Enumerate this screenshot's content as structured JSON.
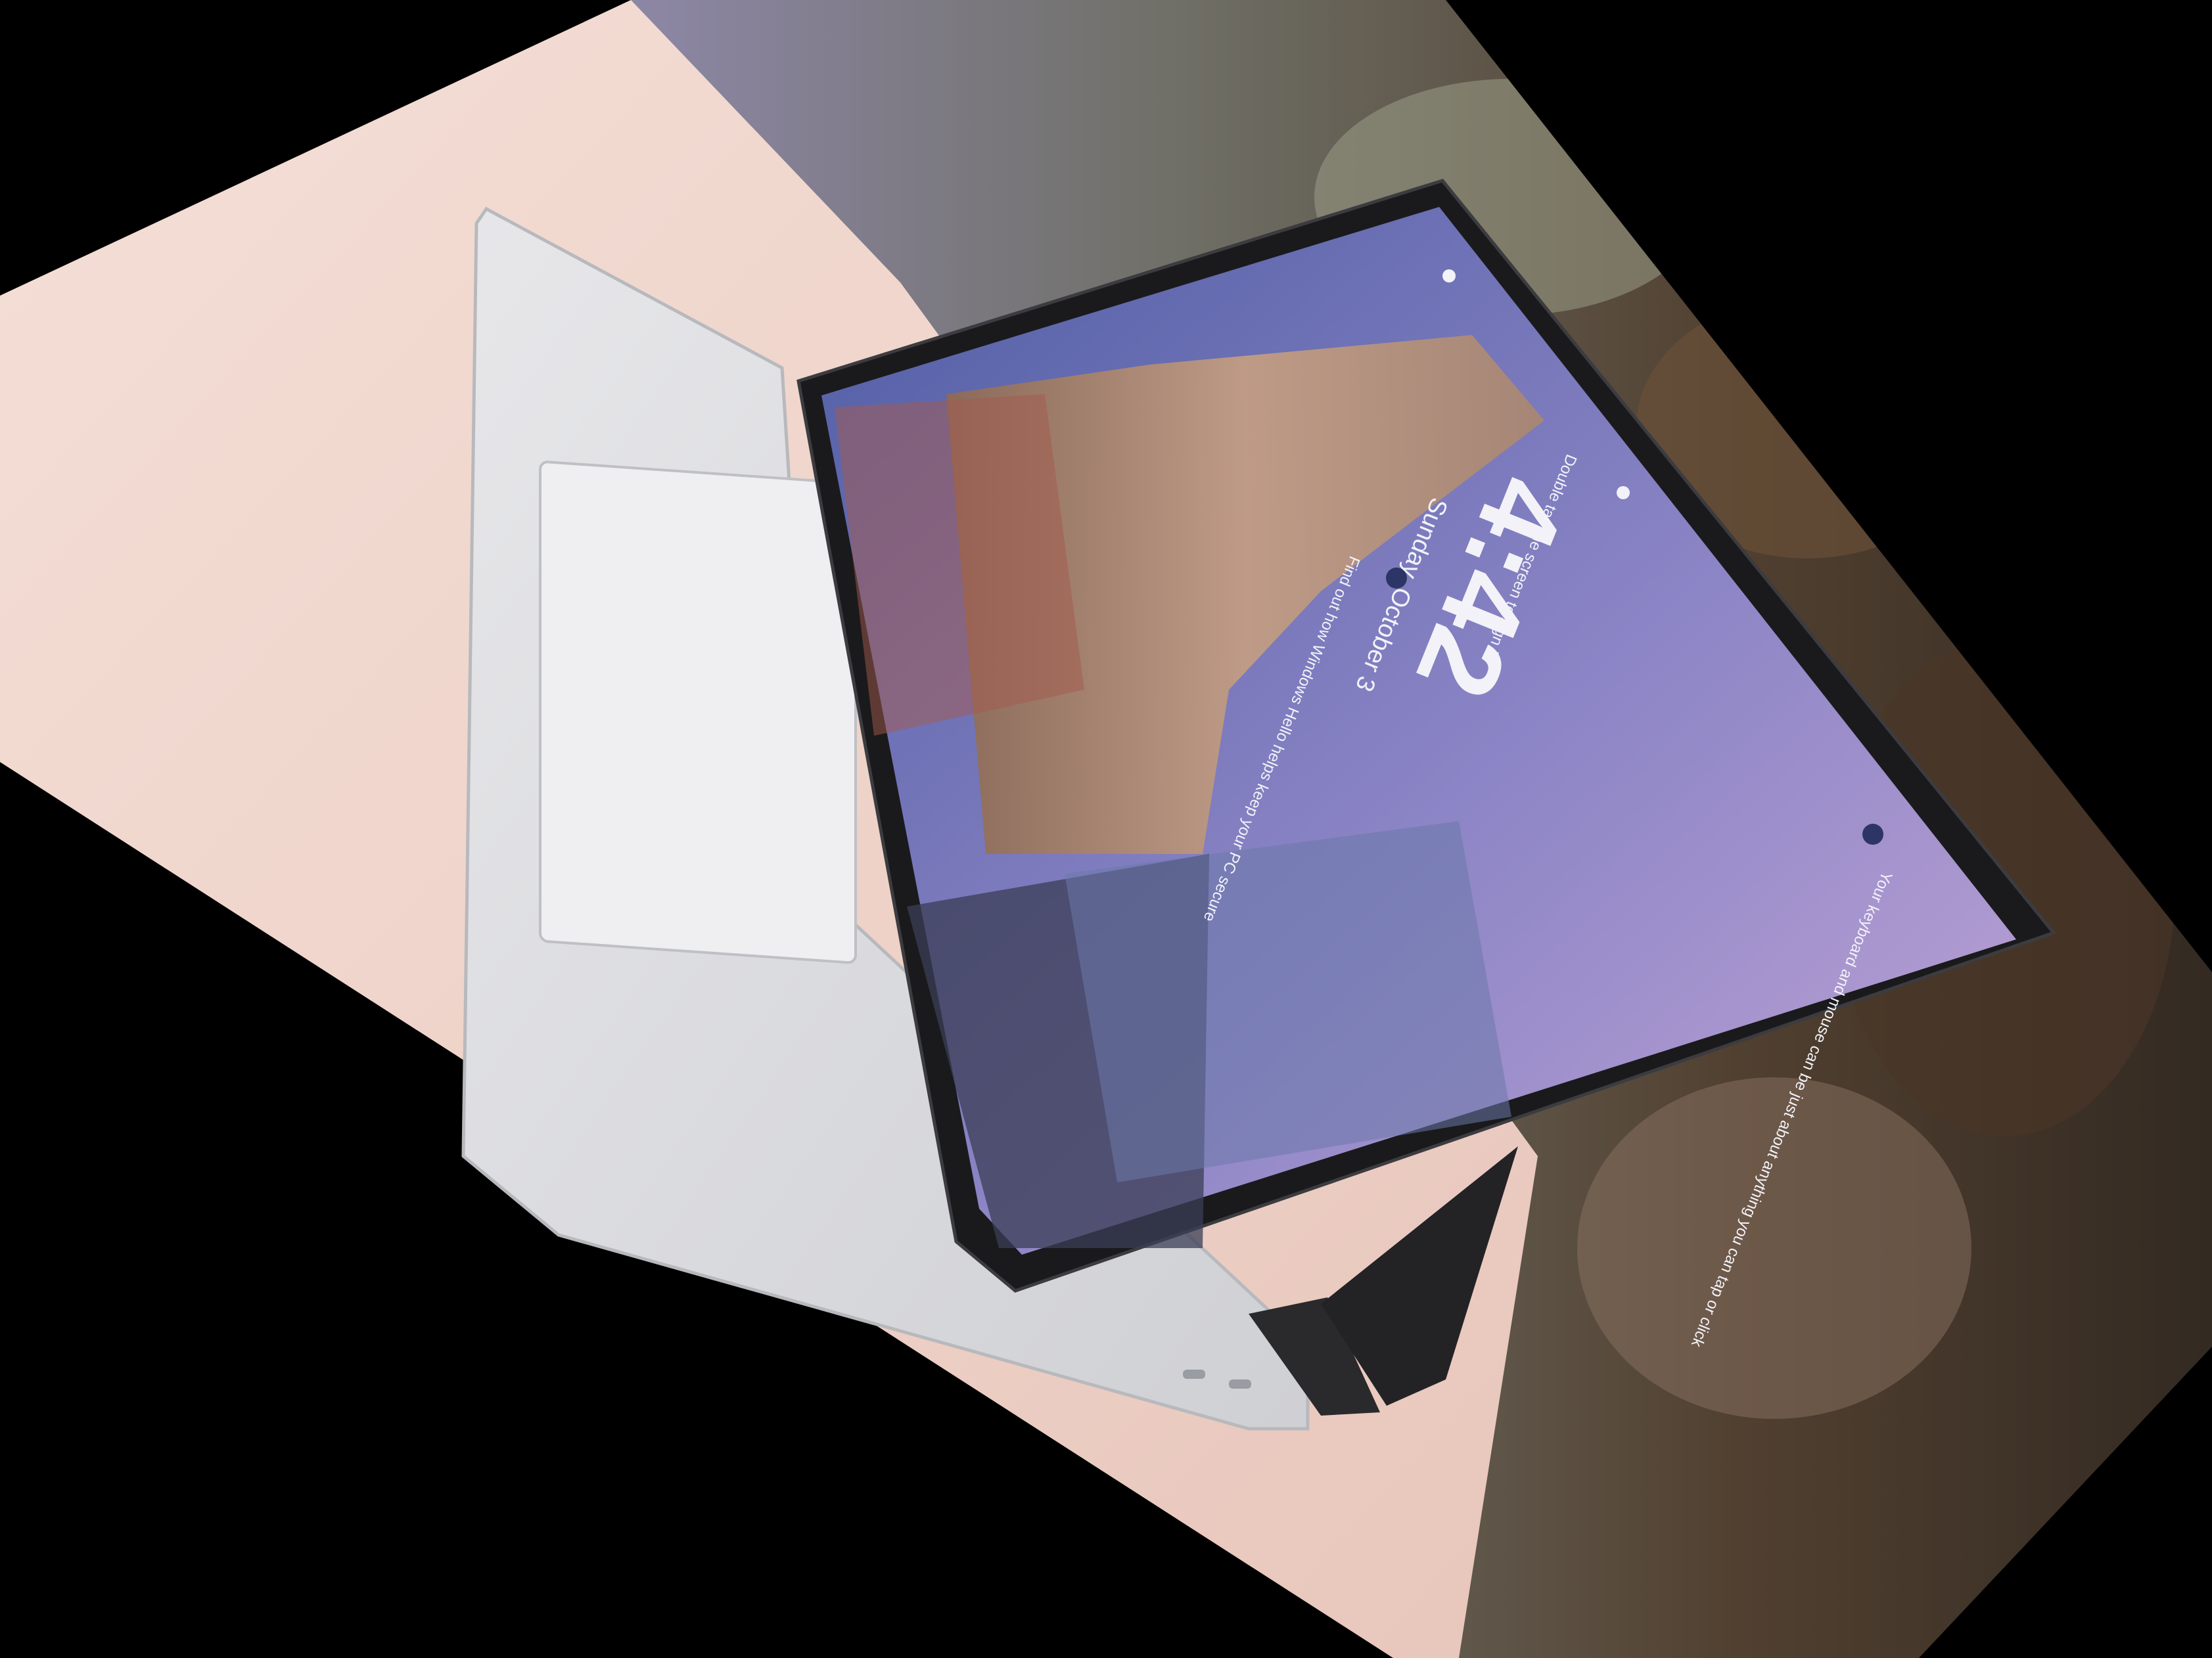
{
  "photo": {
    "subject": "laptop-with-angled-display",
    "colors": {
      "background": "#000000",
      "table": "#f2d9cf",
      "chassis": "#d9d9dc",
      "touchpad": "#ececef",
      "bezel": "#1a1a1c",
      "sky_top": "#4f5da4",
      "sky_bottom": "#b7a1d3",
      "building": "#b9917b"
    }
  },
  "lockscreen": {
    "time": "4:42",
    "date": "Sunday, October 3",
    "hint_top": "Double tap the screen to sign in",
    "tip_one": "Find out how Windows Hello helps keep your PC secure",
    "tip_two": "Your keyboard and mouse can be just about anything you can tap or click"
  }
}
